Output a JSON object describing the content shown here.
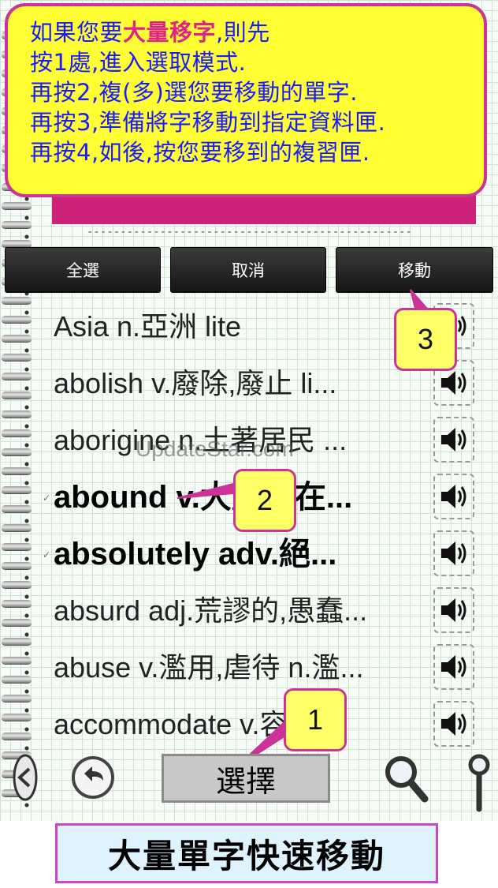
{
  "banner": {
    "lines": [
      {
        "pre": "如果您要",
        "hl": "大量移字",
        "post": ",則先"
      },
      {
        "pre": "按1處,進入選取模式.",
        "hl": "",
        "post": ""
      },
      {
        "pre": "再按2,複(多)選您要移動的單字.",
        "hl": "",
        "post": ""
      },
      {
        "pre": "再按3,準備將字移動到指定資料匣.",
        "hl": "",
        "post": ""
      },
      {
        "pre": "再按4,如後,按您要移到的複習匣.",
        "hl": "",
        "post": ""
      }
    ],
    "text_color": "#1a1aff",
    "highlight_color": "#e0218a",
    "background": "#ffff33",
    "border_color": "#cc3399"
  },
  "divider": "----------------------------------------------------------------------",
  "toolbar": {
    "select_all": "全選",
    "cancel": "取消",
    "move": "移動"
  },
  "words": [
    {
      "text": "Asia  n.亞洲     lite",
      "bold": false,
      "checked": false
    },
    {
      "text": "abolish  v.廢除,廢止     li...",
      "bold": false,
      "checked": false
    },
    {
      "text": "aborigine  n.土著居民     ...",
      "bold": false,
      "checked": false
    },
    {
      "text": "abound  v.大量存在...",
      "bold": true,
      "checked": true
    },
    {
      "text": "absolutely  adv.絕...",
      "bold": true,
      "checked": true
    },
    {
      "text": "absurd  adj.荒謬的,愚蠢...",
      "bold": false,
      "checked": false
    },
    {
      "text": "abuse  v.濫用,虐待  n.濫...",
      "bold": false,
      "checked": false
    },
    {
      "text": "accommodate   v.容...",
      "bold": false,
      "checked": false
    }
  ],
  "speaker_icon": "speaker-icon",
  "watermark": "UpdateStar.com",
  "callouts": {
    "one": "1",
    "two": "2",
    "three": "3"
  },
  "bottom": {
    "select_label": "選擇",
    "back_icon": "back-arrow-icon",
    "search_icon": "magnifier-icon"
  },
  "caption": "大量單字快速移動"
}
